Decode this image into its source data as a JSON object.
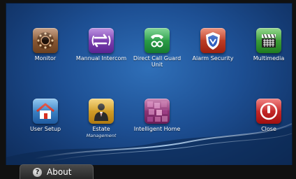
{
  "apps": [
    {
      "id": "monitor",
      "label": "Monitor",
      "sub": "",
      "icon": "camera-lens-icon",
      "color": "#8a5a36"
    },
    {
      "id": "manual_intercom",
      "label": "Mannual Intercom",
      "sub": "",
      "icon": "transfer-arrows-icon",
      "color": "#7a3fb0"
    },
    {
      "id": "direct_call",
      "label": "Direct Call Guard Unit",
      "sub": "",
      "icon": "handset-icon",
      "color": "#2aa54a"
    },
    {
      "id": "alarm_security",
      "label": "Alarm Security",
      "sub": "",
      "icon": "shield-icon",
      "color": "#c8402a"
    },
    {
      "id": "multimedia",
      "label": "Multimedia",
      "sub": "",
      "icon": "clapperboard-icon",
      "color": "#3a9a3a"
    },
    {
      "id": "user_setup",
      "label": "User Setup",
      "sub": "",
      "icon": "house-icon",
      "color": "#3a8fd0"
    },
    {
      "id": "estate_management",
      "label": "Estate",
      "sub": "Management",
      "icon": "manager-icon",
      "color": "#d8a020"
    },
    {
      "id": "intelligent_home",
      "label": "Intelligent Home",
      "sub": "",
      "icon": "mosaic-icon",
      "color": "#9a3a78"
    },
    {
      "id": "close",
      "label": "Close",
      "sub": "",
      "icon": "power-icon",
      "color": "#c82828"
    }
  ],
  "footer": {
    "about_label": "About",
    "help_glyph": "?"
  }
}
